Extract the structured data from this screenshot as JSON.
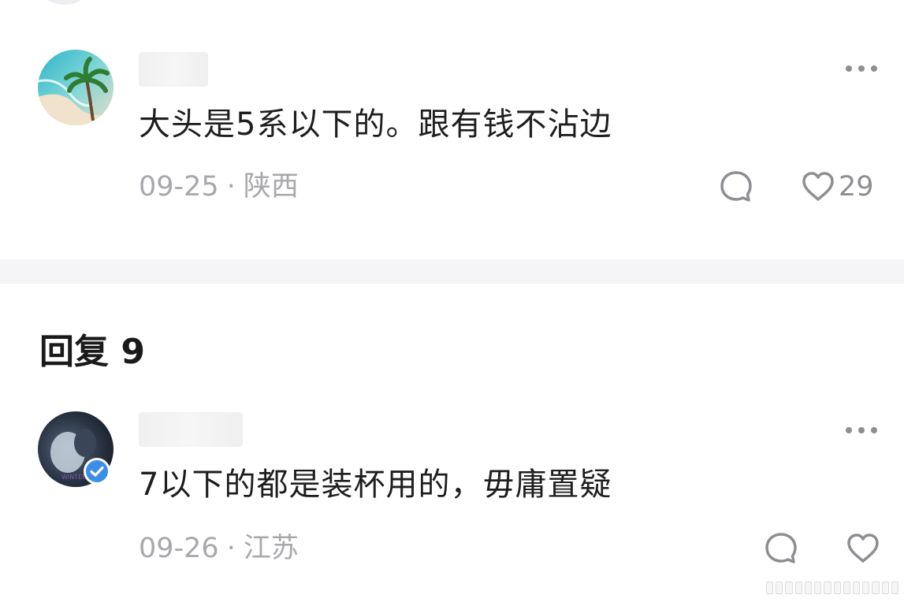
{
  "comments": [
    {
      "text": "大头是5系以下的。跟有钱不沾边",
      "date": "09-25",
      "separator": "·",
      "location": "陕西",
      "likes": "29",
      "avatar_icon": "palm-tree-beach",
      "verified": false
    },
    {
      "text": "7以下的都是装杯用的，毋庸置疑",
      "date": "09-26",
      "separator": "·",
      "location": "江苏",
      "likes": "",
      "avatar_icon": "dark-photo",
      "verified": true
    }
  ],
  "replies_heading": "回复 9",
  "colors": {
    "text_primary": "#1e1e1e",
    "text_meta": "#a8a8ad",
    "icon_gray": "#8e8e93",
    "divider": "#f5f5f7",
    "verified_blue": "#3b8de8"
  }
}
